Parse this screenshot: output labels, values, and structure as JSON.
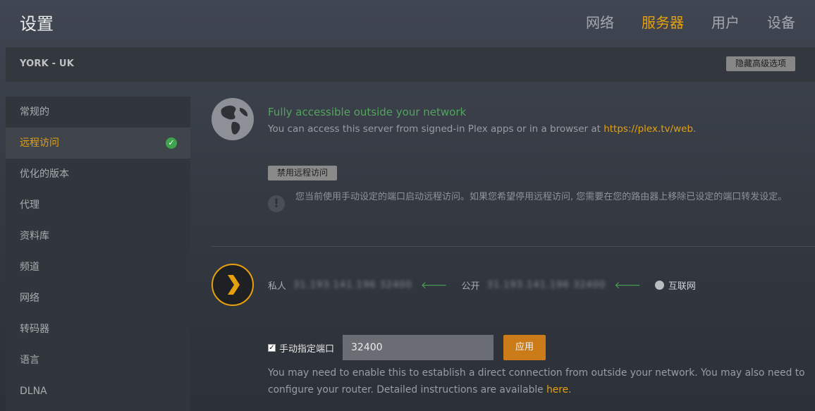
{
  "header": {
    "title": "设置",
    "tabs": [
      {
        "label": "网络",
        "active": false
      },
      {
        "label": "服务器",
        "active": true
      },
      {
        "label": "用户",
        "active": false
      },
      {
        "label": "设备",
        "active": false
      }
    ]
  },
  "server_bar": {
    "name": "YORK - UK",
    "hide_advanced_label": "隐藏高级选项"
  },
  "sidebar": {
    "items": [
      {
        "label": "常规的"
      },
      {
        "label": "远程访问",
        "active": true,
        "status_icon": "check-circle-icon"
      },
      {
        "label": "优化的版本"
      },
      {
        "label": "代理"
      },
      {
        "label": "资料库"
      },
      {
        "label": "频道"
      },
      {
        "label": "网络"
      },
      {
        "label": "转码器"
      },
      {
        "label": "语言"
      },
      {
        "label": "DLNA"
      }
    ]
  },
  "remote_access": {
    "status_title": "Fully accessible outside your network",
    "status_desc": "You can access this server from signed-in Plex apps or in a browser at ",
    "status_link": "https://plex.tv/web",
    "status_desc_end": ".",
    "disable_button": "禁用远程访问",
    "info_text": "您当前使用手动设定的端口启动远程访问。如果您希望停用远程访问, 您需要在您的路由器上移除已设定的端口转发设定。",
    "private_label": "私人",
    "private_ip": "31.193.141.196   32400",
    "public_label": "公开",
    "public_ip": "31.193.141.196   32400",
    "internet_label": "互联网",
    "manual_port_label": "手动指定端口",
    "manual_port_checked": true,
    "port_value": "32400",
    "apply_button": "应用",
    "help_text": "You may need to enable this to establish a direct connection from outside your network. You may also need to configure your router. Detailed instructions are available ",
    "help_link": "here",
    "help_end": "."
  },
  "colors": {
    "accent": "#e5a00d",
    "success": "#53a45e",
    "apply": "#cc7b19"
  }
}
